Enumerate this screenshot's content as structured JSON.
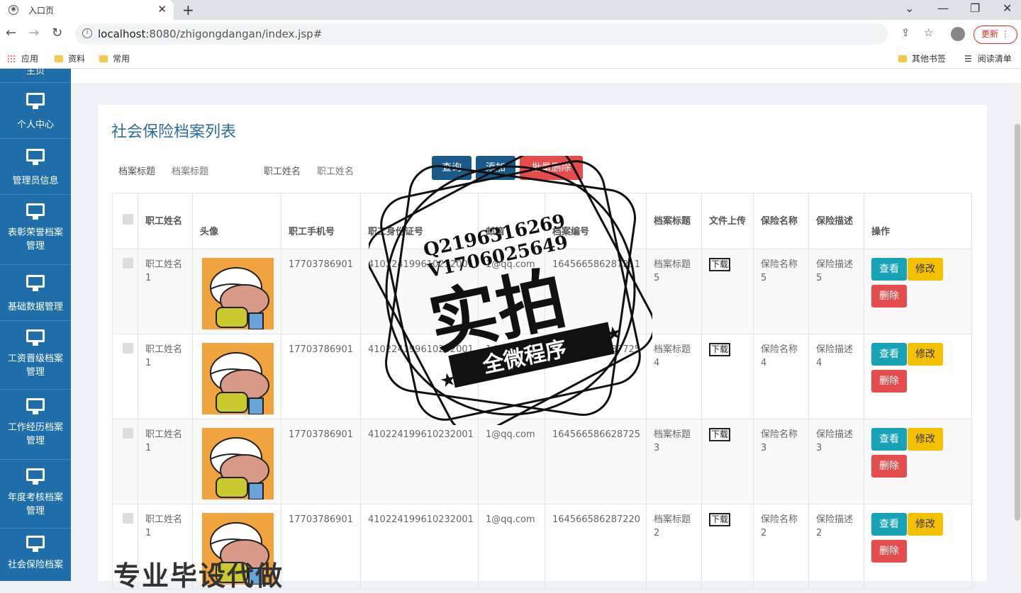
{
  "browser": {
    "tab_title": "入口页",
    "url_host": "localhost",
    "url_rest": ":8080/zhigongdangan/index.jsp#",
    "update_label": "更新",
    "bookmarks": [
      "应用",
      "资料",
      "常用"
    ],
    "bookmarks_right": [
      "其他书签",
      "阅读清单"
    ]
  },
  "sidebar": {
    "items": [
      {
        "label": "主页"
      },
      {
        "label": "个人中心"
      },
      {
        "label": "管理员信息"
      },
      {
        "label": "表彰荣誉档案管理"
      },
      {
        "label": "基础数据管理"
      },
      {
        "label": "工资晋级档案管理"
      },
      {
        "label": "工作经历档案管理"
      },
      {
        "label": "年度考核档案管理"
      },
      {
        "label": "社会保险档案"
      }
    ]
  },
  "page": {
    "title": "社会保险档案列表",
    "filters": [
      {
        "label": "档案标题",
        "placeholder": "档案标题"
      },
      {
        "label": "职工姓名",
        "placeholder": "职工姓名"
      }
    ],
    "buttons": {
      "query": "查询",
      "add": "添加",
      "batch_delete": "批量删除"
    }
  },
  "table": {
    "headers": [
      "职工姓名",
      "头像",
      "职工手机号",
      "职工身份证号",
      "邮箱",
      "档案编号",
      "档案标题",
      "文件上传",
      "保险名称",
      "保险描述",
      "操作"
    ],
    "rows": [
      {
        "name": "职工姓名1",
        "phone": "17703786901",
        "idcard": "410224199610232001",
        "email": "1@qq.com",
        "code": "164566586287211",
        "title": "档案标题5",
        "file": "下载",
        "ins_name": "保险名称5",
        "ins_desc": "保险描述5"
      },
      {
        "name": "职工姓名1",
        "phone": "17703786901",
        "idcard": "410224199610232001",
        "email": "1@qq.com",
        "code": "164566586287725",
        "title": "档案标题4",
        "file": "下载",
        "ins_name": "保险名称4",
        "ins_desc": "保险描述4"
      },
      {
        "name": "职工姓名1",
        "phone": "17703786901",
        "idcard": "410224199610232001",
        "email": "1@qq.com",
        "code": "164566586628725",
        "title": "档案标题3",
        "file": "下载",
        "ins_name": "保险名称3",
        "ins_desc": "保险描述3"
      },
      {
        "name": "职工姓名1",
        "phone": "17703786901",
        "idcard": "410224199610232001",
        "email": "1@qq.com",
        "code": "164566586287220",
        "title": "档案标题2",
        "file": "下载",
        "ins_name": "保险名称2",
        "ins_desc": "保险描述2"
      }
    ],
    "actions": {
      "view": "查看",
      "edit": "修改",
      "delete": "删除"
    }
  },
  "watermark": {
    "contact_q": "Q2196316269",
    "contact_v": "V1706025649",
    "big": "实拍",
    "banner": "全微程序",
    "bottom": "专业毕设代做"
  }
}
